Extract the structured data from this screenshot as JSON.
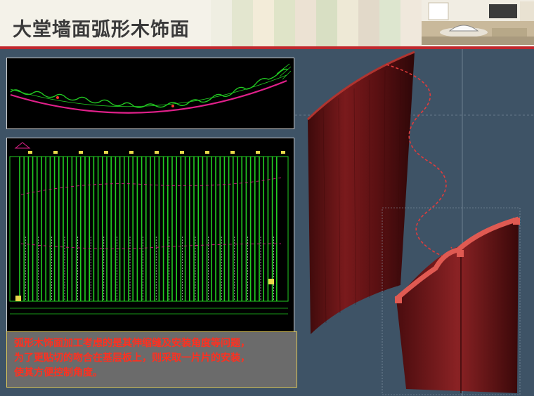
{
  "slide": {
    "title": "大堂墙面弧形木饰面",
    "note_lines": [
      "弧形木饰面加工考虑的是其伸缩缝及安装角度等问题，",
      "为了更贴切的吻合在基层板上，则采取一片片的安装，",
      "使其方便控制角度。"
    ]
  },
  "colors": {
    "accent_red": "#c0272d",
    "note_text": "#ff3020",
    "stage_background": "#3e5366",
    "cad_green": "#22cc22",
    "cad_magenta": "#e0208a",
    "wood": "#6a1416"
  },
  "icons": [
    "room-photo",
    "cad-plan-drawing",
    "cad-elevation-drawing",
    "wood-panel-render"
  ]
}
